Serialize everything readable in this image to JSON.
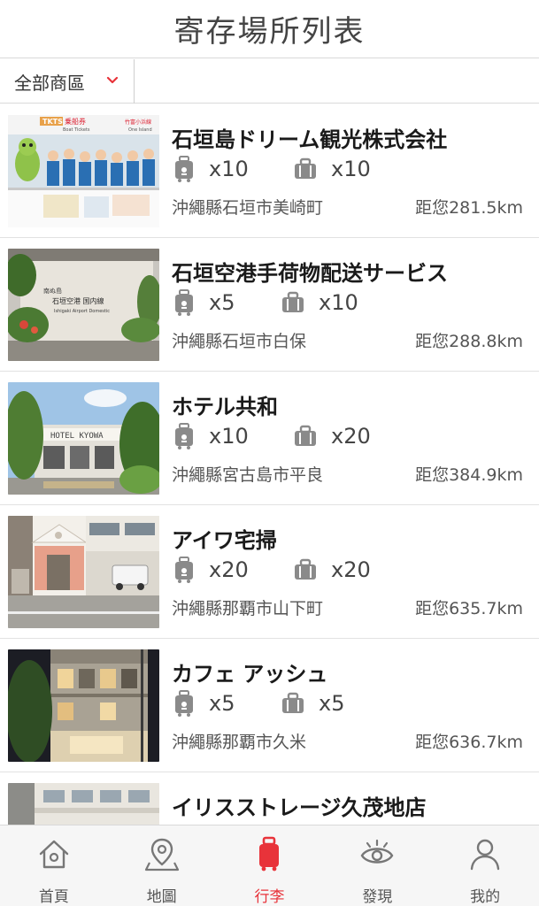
{
  "header": {
    "title": "寄存場所列表"
  },
  "filter": {
    "selected": "全部商區"
  },
  "list": {
    "items": [
      {
        "title": "石垣島ドリーム観光株式会社",
        "small_bags": "x10",
        "large_bags": "x10",
        "address": "沖繩縣石垣市美崎町",
        "distance": "距您281.5km",
        "photo_signage": [
          "TKTS",
          "乗船券",
          "Boat Tickets",
          "竹富小浜線",
          "One Island"
        ]
      },
      {
        "title": "石垣空港手荷物配送サービス",
        "small_bags": "x5",
        "large_bags": "x10",
        "address": "沖繩縣石垣市白保",
        "distance": "距您288.8km",
        "photo_signage": [
          "南ぬ島",
          "石垣空港 国内線",
          "Ishigaki Airport Domestic"
        ]
      },
      {
        "title": "ホテル共和",
        "small_bags": "x10",
        "large_bags": "x20",
        "address": "沖繩縣宮古島市平良",
        "distance": "距您384.9km",
        "photo_signage": [
          "HOTEL KYOWA"
        ]
      },
      {
        "title": "アイワ宅掃",
        "small_bags": "x20",
        "large_bags": "x20",
        "address": "沖繩縣那覇市山下町",
        "distance": "距您635.7km"
      },
      {
        "title": "カフェ アッシュ",
        "small_bags": "x5",
        "large_bags": "x5",
        "address": "沖繩縣那覇市久米",
        "distance": "距您636.7km"
      },
      {
        "title": "イリスストレージ久茂地店"
      }
    ]
  },
  "tabbar": {
    "tabs": [
      {
        "label": "首頁",
        "icon": "home-icon"
      },
      {
        "label": "地圖",
        "icon": "map-pin-icon"
      },
      {
        "label": "行李",
        "icon": "luggage-icon",
        "active": true
      },
      {
        "label": "發現",
        "icon": "eye-icon"
      },
      {
        "label": "我的",
        "icon": "user-icon"
      }
    ]
  },
  "colors": {
    "accent": "#e8333a",
    "text": "#222222",
    "muted": "#555555",
    "tabbar_bg": "#f6f6f6"
  }
}
